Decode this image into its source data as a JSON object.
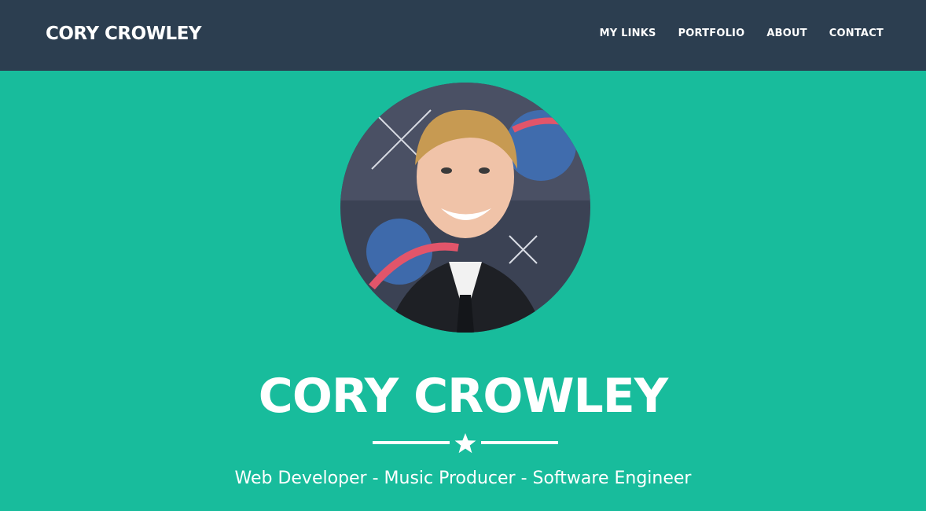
{
  "navbar": {
    "brand": "CORY CROWLEY",
    "links": [
      {
        "label": "MY LINKS"
      },
      {
        "label": "PORTFOLIO"
      },
      {
        "label": "ABOUT"
      },
      {
        "label": "CONTACT"
      }
    ]
  },
  "hero": {
    "name": "CORY CROWLEY",
    "tagline": "Web Developer - Music Producer - Software Engineer",
    "divider_icon": "star-icon",
    "avatar_icon": "profile-photo"
  },
  "colors": {
    "navbar_bg": "#2c3e50",
    "hero_bg": "#18bc9c",
    "text": "#ffffff"
  }
}
